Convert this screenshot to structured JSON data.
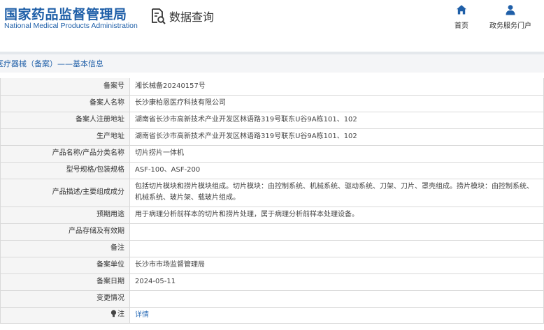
{
  "header": {
    "logo_cn": "国家药品监督管理局",
    "logo_en": "National Medical Products Administration",
    "query_title": "数据查询",
    "query_icon": "document-search-icon",
    "nav": [
      {
        "label": "首页",
        "icon": "home-icon"
      },
      {
        "label": "政务服务门户",
        "icon": "user-icon"
      }
    ]
  },
  "colors": {
    "brand_blue": "#1f5fa8",
    "label_bg": "#f5f5f5",
    "border": "#d9d9d9",
    "breadcrumb_bg": "#f4f5f7",
    "link": "#2f6fb8"
  },
  "breadcrumb": "医疗器械（备案）——基本信息",
  "record": {
    "rows": [
      {
        "label": "备案号",
        "value": "湘长械备20240157号"
      },
      {
        "label": "备案人名称",
        "value": "长沙康柏恩医疗科技有限公司"
      },
      {
        "label": "备案人注册地址",
        "value": "湖南省长沙市高新技术产业开发区林语路319号联东U谷9A栋101、102"
      },
      {
        "label": "生产地址",
        "value": "湖南省长沙市高新技术产业开发区林语路319号联东U谷9A栋101、102"
      },
      {
        "label": "产品名称/产品分类名称",
        "value": "切片捞片一体机"
      },
      {
        "label": "型号规格/包装规格",
        "value": "ASF-100、ASF-200"
      },
      {
        "label": "产品描述/主要组成成分",
        "value": "包括切片模块和捞片模块组成。切片模块：由控制系统、机械系统、驱动系统、刀架、刀片、罩壳组成。捞片模块：由控制系统、机械系统、玻片架、载玻片组成。"
      },
      {
        "label": "预期用途",
        "value": "用于病理分析前样本的切片和捞片处理，属于病理分析前样本处理设备。"
      },
      {
        "label": "产品存储及有效期",
        "value": ""
      },
      {
        "label": "备注",
        "value": ""
      },
      {
        "label": "备案单位",
        "value": "长沙市市场监督管理局"
      },
      {
        "label": "备案日期",
        "value": "2024-05-11"
      },
      {
        "label": "变更情况",
        "value": ""
      },
      {
        "label": "注",
        "value": "详情",
        "icon": "bulb-icon"
      }
    ]
  }
}
